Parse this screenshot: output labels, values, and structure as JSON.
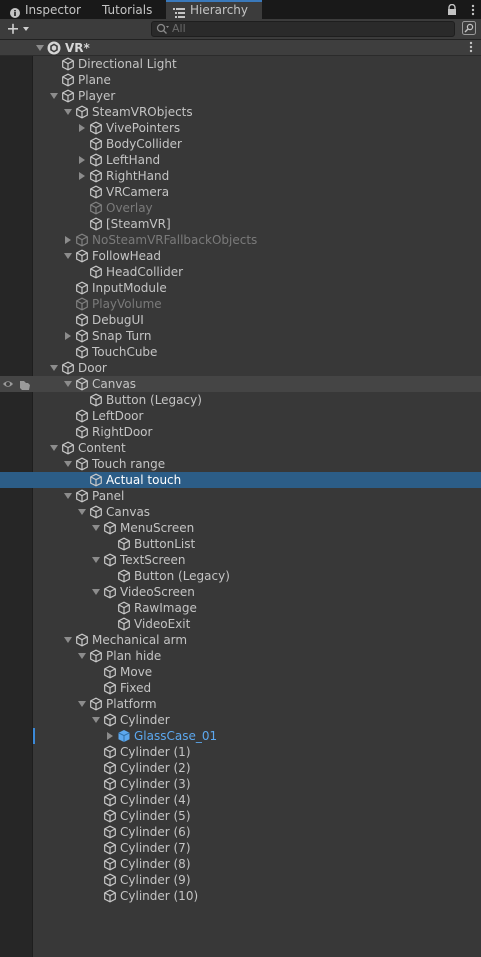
{
  "tabs": [
    {
      "label": "Inspector",
      "icon": "info-icon"
    },
    {
      "label": "Tutorials"
    },
    {
      "label": "Hierarchy",
      "icon": "hierarchy-list-icon",
      "active": true
    }
  ],
  "toolbar": {
    "search_placeholder": "All"
  },
  "root": {
    "label": "VR*",
    "icon": "unity-scene-icon"
  },
  "tree": [
    {
      "label": "Directional Light",
      "depth": 1,
      "expand": "none"
    },
    {
      "label": "Plane",
      "depth": 1,
      "expand": "none"
    },
    {
      "label": "Player",
      "depth": 1,
      "expand": "open"
    },
    {
      "label": "SteamVRObjects",
      "depth": 2,
      "expand": "open"
    },
    {
      "label": "VivePointers",
      "depth": 3,
      "expand": "closed"
    },
    {
      "label": "BodyCollider",
      "depth": 3,
      "expand": "none"
    },
    {
      "label": "LeftHand",
      "depth": 3,
      "expand": "closed"
    },
    {
      "label": "RightHand",
      "depth": 3,
      "expand": "closed"
    },
    {
      "label": "VRCamera",
      "depth": 3,
      "expand": "none"
    },
    {
      "label": "Overlay",
      "depth": 3,
      "expand": "none",
      "state": "inactive"
    },
    {
      "label": "[SteamVR]",
      "depth": 3,
      "expand": "none"
    },
    {
      "label": "NoSteamVRFallbackObjects",
      "depth": 2,
      "expand": "closed",
      "state": "inactive"
    },
    {
      "label": "FollowHead",
      "depth": 2,
      "expand": "open"
    },
    {
      "label": "HeadCollider",
      "depth": 3,
      "expand": "none"
    },
    {
      "label": "InputModule",
      "depth": 2,
      "expand": "none"
    },
    {
      "label": "PlayVolume",
      "depth": 2,
      "expand": "none",
      "state": "inactive"
    },
    {
      "label": "DebugUI",
      "depth": 2,
      "expand": "none"
    },
    {
      "label": "Snap Turn",
      "depth": 2,
      "expand": "closed"
    },
    {
      "label": "TouchCube",
      "depth": 2,
      "expand": "none"
    },
    {
      "label": "Door",
      "depth": 1,
      "expand": "open"
    },
    {
      "label": "Canvas",
      "depth": 2,
      "expand": "open",
      "state": "hover"
    },
    {
      "label": "Button (Legacy)",
      "depth": 3,
      "expand": "none"
    },
    {
      "label": "LeftDoor",
      "depth": 2,
      "expand": "none"
    },
    {
      "label": "RightDoor",
      "depth": 2,
      "expand": "none"
    },
    {
      "label": "Content",
      "depth": 1,
      "expand": "open"
    },
    {
      "label": "Touch range",
      "depth": 2,
      "expand": "open"
    },
    {
      "label": "Actual touch",
      "depth": 3,
      "expand": "none",
      "state": "selected"
    },
    {
      "label": "Panel",
      "depth": 2,
      "expand": "open"
    },
    {
      "label": "Canvas",
      "depth": 3,
      "expand": "open"
    },
    {
      "label": "MenuScreen",
      "depth": 4,
      "expand": "open"
    },
    {
      "label": "ButtonList",
      "depth": 5,
      "expand": "none"
    },
    {
      "label": "TextScreen",
      "depth": 4,
      "expand": "open"
    },
    {
      "label": "Button (Legacy)",
      "depth": 5,
      "expand": "none"
    },
    {
      "label": "VideoScreen",
      "depth": 4,
      "expand": "open"
    },
    {
      "label": "RawImage",
      "depth": 5,
      "expand": "none"
    },
    {
      "label": "VideoExit",
      "depth": 5,
      "expand": "none"
    },
    {
      "label": "Mechanical arm",
      "depth": 2,
      "expand": "open"
    },
    {
      "label": "Plan hide",
      "depth": 3,
      "expand": "open"
    },
    {
      "label": "Move",
      "depth": 4,
      "expand": "none"
    },
    {
      "label": "Fixed",
      "depth": 4,
      "expand": "none"
    },
    {
      "label": "Platform",
      "depth": 3,
      "expand": "open"
    },
    {
      "label": "Cylinder",
      "depth": 4,
      "expand": "open"
    },
    {
      "label": "GlassCase_01",
      "depth": 5,
      "expand": "closed",
      "state": "prefab"
    },
    {
      "label": "Cylinder (1)",
      "depth": 4,
      "expand": "none"
    },
    {
      "label": "Cylinder (2)",
      "depth": 4,
      "expand": "none"
    },
    {
      "label": "Cylinder (3)",
      "depth": 4,
      "expand": "none"
    },
    {
      "label": "Cylinder (4)",
      "depth": 4,
      "expand": "none"
    },
    {
      "label": "Cylinder (5)",
      "depth": 4,
      "expand": "none"
    },
    {
      "label": "Cylinder (6)",
      "depth": 4,
      "expand": "none"
    },
    {
      "label": "Cylinder (7)",
      "depth": 4,
      "expand": "none"
    },
    {
      "label": "Cylinder (8)",
      "depth": 4,
      "expand": "none"
    },
    {
      "label": "Cylinder (9)",
      "depth": 4,
      "expand": "none"
    },
    {
      "label": "Cylinder (10)",
      "depth": 4,
      "expand": "none"
    }
  ],
  "colors": {
    "selection": "#2c5d87",
    "prefab_text": "#5ca8ef",
    "active_tab_accent": "#3a79bb"
  }
}
